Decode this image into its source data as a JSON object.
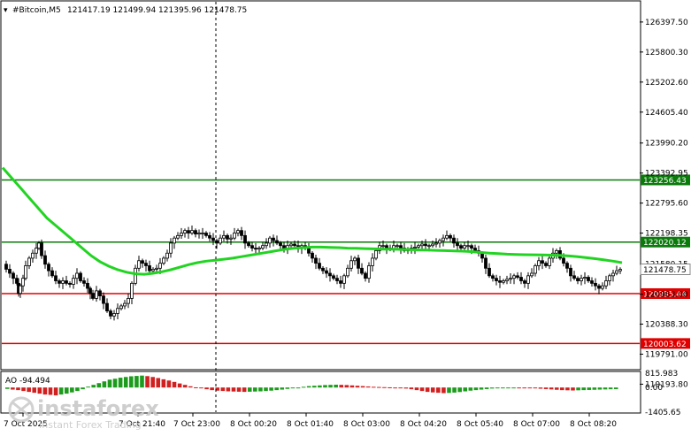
{
  "header": {
    "symbol": "#Bitcoin,M5",
    "ohlc": "121417.19 121499.94 121395.96 121478.75"
  },
  "chart_data": {
    "type": "candlestick",
    "ylim": [
      119500,
      126800
    ],
    "price_ticks": [
      "126397.50",
      "125800.30",
      "125202.60",
      "124605.40",
      "123990.20",
      "123392.95",
      "122795.60",
      "122198.35",
      "121580.15",
      "120983.00",
      "120388.30",
      "119791.00",
      "119193.80"
    ],
    "levels": [
      {
        "label": "123256.43",
        "value": 123256.43,
        "color": "#0a7a0a"
      },
      {
        "label": "122020.12",
        "value": 122020.12,
        "color": "#0a7a0a"
      },
      {
        "label": "120995.44",
        "value": 120995.44,
        "color": "#e00000"
      },
      {
        "label": "120003.62",
        "value": 120003.62,
        "color": "#e00000"
      }
    ],
    "last_price": "121478.75",
    "time_labels": [
      "7 Oct 2025",
      "7 Oct 21:40",
      "7 Oct 23:00",
      "8 Oct 00:20",
      "8 Oct 01:40",
      "8 Oct 03:00",
      "8 Oct 04:20",
      "8 Oct 05:40",
      "8 Oct 07:00",
      "8 Oct 08:20"
    ],
    "close_path": [
      [
        0,
        121580
      ],
      [
        4,
        121480
      ],
      [
        8,
        121400
      ],
      [
        12,
        121300
      ],
      [
        16,
        121200
      ],
      [
        18,
        121000
      ],
      [
        20,
        121150
      ],
      [
        23,
        121300
      ],
      [
        26,
        121550
      ],
      [
        30,
        121700
      ],
      [
        34,
        121800
      ],
      [
        38,
        121900
      ],
      [
        41,
        122000
      ],
      [
        44,
        121750
      ],
      [
        48,
        121580
      ],
      [
        52,
        121450
      ],
      [
        56,
        121350
      ],
      [
        60,
        121250
      ],
      [
        64,
        121200
      ],
      [
        68,
        121250
      ],
      [
        72,
        121200
      ],
      [
        76,
        121180
      ],
      [
        80,
        121300
      ],
      [
        84,
        121400
      ],
      [
        88,
        121250
      ],
      [
        92,
        121200
      ],
      [
        96,
        121100
      ],
      [
        99,
        121000
      ],
      [
        102,
        120900
      ],
      [
        106,
        121050
      ],
      [
        110,
        120950
      ],
      [
        114,
        120800
      ],
      [
        118,
        120650
      ],
      [
        122,
        120550
      ],
      [
        126,
        120600
      ],
      [
        130,
        120700
      ],
      [
        134,
        120750
      ],
      [
        138,
        120800
      ],
      [
        142,
        120900
      ],
      [
        146,
        121200
      ],
      [
        150,
        121500
      ],
      [
        154,
        121650
      ],
      [
        158,
        121600
      ],
      [
        162,
        121550
      ],
      [
        166,
        121450
      ],
      [
        170,
        121480
      ],
      [
        174,
        121500
      ],
      [
        178,
        121600
      ],
      [
        182,
        121700
      ],
      [
        186,
        121800
      ],
      [
        190,
        122000
      ],
      [
        194,
        122100
      ],
      [
        198,
        122150
      ],
      [
        202,
        122200
      ],
      [
        206,
        122250
      ],
      [
        210,
        122200
      ],
      [
        214,
        122250
      ],
      [
        218,
        122180
      ],
      [
        222,
        122200
      ],
      [
        226,
        122200
      ],
      [
        230,
        122150
      ],
      [
        234,
        122100
      ],
      [
        238,
        122050
      ],
      [
        242,
        122000
      ],
      [
        246,
        122100
      ],
      [
        250,
        122150
      ],
      [
        254,
        122080
      ],
      [
        258,
        122100
      ],
      [
        262,
        122200
      ],
      [
        266,
        122250
      ],
      [
        270,
        122150
      ],
      [
        274,
        122000
      ],
      [
        278,
        121950
      ],
      [
        282,
        121900
      ],
      [
        286,
        121880
      ],
      [
        290,
        121900
      ],
      [
        294,
        121950
      ],
      [
        298,
        122000
      ],
      [
        302,
        122100
      ],
      [
        306,
        122050
      ],
      [
        310,
        122000
      ],
      [
        314,
        121950
      ],
      [
        318,
        121900
      ],
      [
        322,
        121950
      ],
      [
        326,
        121980
      ],
      [
        330,
        121950
      ],
      [
        334,
        121900
      ],
      [
        338,
        121950
      ],
      [
        342,
        121900
      ],
      [
        346,
        121800
      ],
      [
        350,
        121700
      ],
      [
        354,
        121600
      ],
      [
        358,
        121500
      ],
      [
        362,
        121450
      ],
      [
        366,
        121400
      ],
      [
        370,
        121350
      ],
      [
        374,
        121300
      ],
      [
        378,
        121250
      ],
      [
        382,
        121200
      ],
      [
        386,
        121350
      ],
      [
        390,
        121500
      ],
      [
        394,
        121650
      ],
      [
        398,
        121700
      ],
      [
        402,
        121500
      ],
      [
        406,
        121400
      ],
      [
        410,
        121300
      ],
      [
        414,
        121550
      ],
      [
        418,
        121700
      ],
      [
        422,
        121850
      ],
      [
        426,
        121950
      ],
      [
        430,
        121950
      ],
      [
        434,
        121900
      ],
      [
        438,
        121880
      ],
      [
        442,
        121950
      ],
      [
        446,
        121950
      ],
      [
        450,
        121900
      ],
      [
        454,
        121850
      ],
      [
        458,
        121880
      ],
      [
        462,
        121900
      ],
      [
        466,
        121920
      ],
      [
        470,
        121950
      ],
      [
        474,
        121980
      ],
      [
        478,
        121950
      ],
      [
        482,
        121950
      ],
      [
        486,
        121980
      ],
      [
        490,
        122000
      ],
      [
        494,
        122050
      ],
      [
        498,
        122100
      ],
      [
        502,
        122150
      ],
      [
        506,
        122100
      ],
      [
        510,
        122000
      ],
      [
        514,
        121950
      ],
      [
        518,
        121900
      ],
      [
        522,
        121950
      ],
      [
        526,
        121950
      ],
      [
        530,
        121900
      ],
      [
        534,
        121850
      ],
      [
        538,
        121800
      ],
      [
        542,
        121700
      ],
      [
        546,
        121500
      ],
      [
        550,
        121350
      ],
      [
        554,
        121300
      ],
      [
        558,
        121250
      ],
      [
        562,
        121220
      ],
      [
        566,
        121250
      ],
      [
        570,
        121280
      ],
      [
        574,
        121300
      ],
      [
        578,
        121350
      ],
      [
        582,
        121320
      ],
      [
        586,
        121250
      ],
      [
        590,
        121200
      ],
      [
        594,
        121350
      ],
      [
        598,
        121400
      ],
      [
        602,
        121550
      ],
      [
        606,
        121650
      ],
      [
        610,
        121600
      ],
      [
        614,
        121550
      ],
      [
        618,
        121700
      ],
      [
        622,
        121800
      ],
      [
        626,
        121850
      ],
      [
        630,
        121700
      ],
      [
        634,
        121600
      ],
      [
        638,
        121500
      ],
      [
        642,
        121350
      ],
      [
        646,
        121300
      ],
      [
        650,
        121250
      ],
      [
        654,
        121300
      ],
      [
        658,
        121320
      ],
      [
        662,
        121250
      ],
      [
        666,
        121200
      ],
      [
        670,
        121150
      ],
      [
        674,
        121100
      ],
      [
        678,
        121150
      ],
      [
        682,
        121250
      ],
      [
        686,
        121350
      ],
      [
        690,
        121400
      ],
      [
        694,
        121450
      ],
      [
        698,
        121478
      ]
    ],
    "ma_path": [
      [
        0,
        123500
      ],
      [
        10,
        123300
      ],
      [
        20,
        123100
      ],
      [
        30,
        122900
      ],
      [
        40,
        122700
      ],
      [
        50,
        122500
      ],
      [
        60,
        122350
      ],
      [
        70,
        122200
      ],
      [
        80,
        122050
      ],
      [
        90,
        121900
      ],
      [
        100,
        121750
      ],
      [
        110,
        121630
      ],
      [
        120,
        121540
      ],
      [
        130,
        121470
      ],
      [
        140,
        121420
      ],
      [
        150,
        121390
      ],
      [
        160,
        121380
      ],
      [
        170,
        121400
      ],
      [
        180,
        121430
      ],
      [
        190,
        121470
      ],
      [
        200,
        121520
      ],
      [
        210,
        121570
      ],
      [
        220,
        121610
      ],
      [
        230,
        121640
      ],
      [
        240,
        121660
      ],
      [
        250,
        121680
      ],
      [
        260,
        121700
      ],
      [
        270,
        121730
      ],
      [
        280,
        121760
      ],
      [
        290,
        121790
      ],
      [
        300,
        121820
      ],
      [
        310,
        121850
      ],
      [
        320,
        121880
      ],
      [
        330,
        121900
      ],
      [
        340,
        121910
      ],
      [
        350,
        121920
      ],
      [
        360,
        121920
      ],
      [
        370,
        121915
      ],
      [
        380,
        121910
      ],
      [
        390,
        121900
      ],
      [
        400,
        121895
      ],
      [
        410,
        121890
      ],
      [
        420,
        121885
      ],
      [
        430,
        121880
      ],
      [
        440,
        121878
      ],
      [
        450,
        121875
      ],
      [
        460,
        121870
      ],
      [
        470,
        121865
      ],
      [
        480,
        121860
      ],
      [
        490,
        121855
      ],
      [
        500,
        121850
      ],
      [
        510,
        121845
      ],
      [
        520,
        121840
      ],
      [
        530,
        121830
      ],
      [
        540,
        121815
      ],
      [
        550,
        121800
      ],
      [
        560,
        121790
      ],
      [
        570,
        121780
      ],
      [
        580,
        121775
      ],
      [
        590,
        121770
      ],
      [
        600,
        121768
      ],
      [
        610,
        121765
      ],
      [
        620,
        121760
      ],
      [
        630,
        121755
      ],
      [
        640,
        121745
      ],
      [
        650,
        121730
      ],
      [
        660,
        121710
      ],
      [
        670,
        121690
      ],
      [
        680,
        121665
      ],
      [
        690,
        121640
      ],
      [
        700,
        121610
      ]
    ],
    "ao": {
      "label": "AO -94.494",
      "ticks": [
        "815.983",
        "0.00",
        "-1405.65"
      ],
      "range": [
        -1405.65,
        815.983
      ],
      "values": [
        -80,
        -120,
        -150,
        -200,
        -250,
        -300,
        -350,
        -400,
        -420,
        -450,
        -400,
        -350,
        -280,
        -200,
        -100,
        50,
        150,
        250,
        350,
        450,
        500,
        560,
        600,
        640,
        660,
        680,
        650,
        600,
        540,
        470,
        400,
        320,
        230,
        150,
        70,
        10,
        -50,
        -100,
        -150,
        -180,
        -200,
        -220,
        -230,
        -240,
        -250,
        -240,
        -230,
        -220,
        -200,
        -180,
        -150,
        -120,
        -80,
        -40,
        0,
        40,
        80,
        100,
        120,
        140,
        150,
        160,
        150,
        140,
        120,
        100,
        80,
        60,
        40,
        30,
        20,
        10,
        -10,
        -30,
        -60,
        -100,
        -150,
        -200,
        -250,
        -280,
        -300,
        -320,
        -310,
        -290,
        -260,
        -220,
        -180,
        -150,
        -120,
        -90,
        -60,
        -40,
        -20,
        -10,
        0,
        -10,
        -20,
        -30,
        -50,
        -70,
        -90,
        -110,
        -130,
        -150,
        -160,
        -170,
        -160,
        -150,
        -140,
        -130,
        -120,
        -110,
        -100,
        -94
      ]
    }
  },
  "watermark": {
    "brand": "instaforex",
    "tagline": "Instant Forex Trading"
  },
  "colors": {
    "bull": "#000000",
    "bear": "#000000",
    "ma": "#22d422",
    "ao_up": "#1c9b1c",
    "ao_down": "#d02020",
    "grid": "#c8c8c8"
  }
}
